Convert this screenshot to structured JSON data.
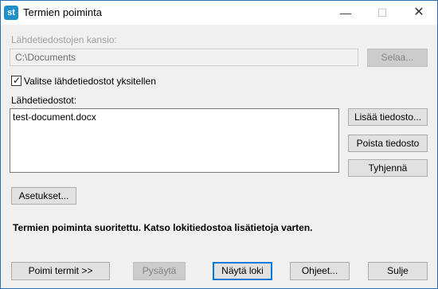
{
  "window": {
    "title": "Termien poiminta",
    "app_icon_text": "st",
    "controls": {
      "minimize": "—",
      "maximize": "☐",
      "close": "✕"
    }
  },
  "source_folder": {
    "label": "Lähdetiedostojen kansio:",
    "value": "C:\\Documents",
    "browse_label": "Selaa..."
  },
  "select_individually": {
    "label": "Valitse lähdetiedostot yksitellen",
    "checked": true
  },
  "source_files": {
    "label": "Lähdetiedostot:",
    "items": [
      "test-document.docx"
    ],
    "add_label": "Lisää tiedosto...",
    "remove_label": "Poista tiedosto",
    "clear_label": "Tyhjennä"
  },
  "settings_label": "Asetukset...",
  "status_text": "Termien poiminta suoritettu. Katso lokitiedostoa lisätietoja varten.",
  "footer": {
    "extract_label": "Poimi termit >>",
    "stop_label": "Pysäytä",
    "show_log_label": "Näytä loki",
    "help_label": "Ohjeet...",
    "close_label": "Sulje"
  },
  "colors": {
    "accent": "#0078d7",
    "app_icon": "#1f8fc9",
    "window_border": "#2f6db5"
  }
}
